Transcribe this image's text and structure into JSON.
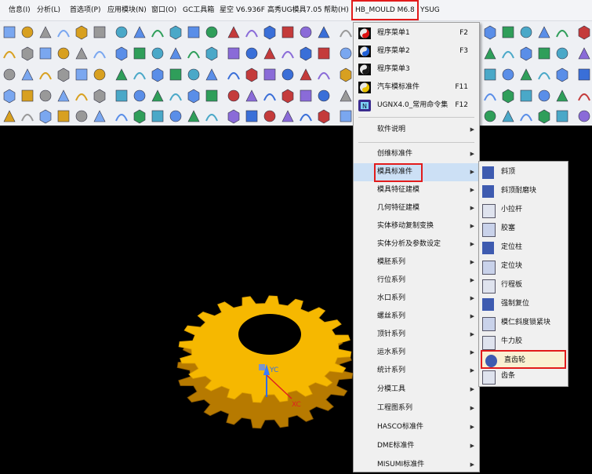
{
  "menubar": {
    "items": [
      "信息(I)",
      "分析(L)",
      "首选项(P)",
      "应用模块(N)",
      "窗口(O)",
      "GC工具箱",
      "星空 V6.936F",
      "高秀UG模具7.05",
      "帮助(H)",
      "HB_MOULD M6.8",
      "YSUG"
    ]
  },
  "main_menu": {
    "items": [
      {
        "label": "程序菜单1",
        "shortcut": "F2"
      },
      {
        "label": "程序菜单2",
        "shortcut": "F3"
      },
      {
        "label": "程序菜单3",
        "shortcut": ""
      },
      {
        "label": "汽车模标准件",
        "shortcut": "F11"
      },
      {
        "label": "UGNX4.0_常用命令集",
        "shortcut": "F12"
      },
      {
        "label": "软件说明",
        "shortcut": ""
      },
      {
        "label": "创维标准件",
        "shortcut": ""
      },
      {
        "label": "模具标准件",
        "shortcut": ""
      },
      {
        "label": "模具特征建模",
        "shortcut": ""
      },
      {
        "label": "几何特征建模",
        "shortcut": ""
      },
      {
        "label": "实体移动复制变换",
        "shortcut": ""
      },
      {
        "label": "实体分析及参数设定",
        "shortcut": ""
      },
      {
        "label": "模胚系列",
        "shortcut": ""
      },
      {
        "label": "行位系列",
        "shortcut": ""
      },
      {
        "label": "水口系列",
        "shortcut": ""
      },
      {
        "label": "螺丝系列",
        "shortcut": ""
      },
      {
        "label": "顶针系列",
        "shortcut": ""
      },
      {
        "label": "运水系列",
        "shortcut": ""
      },
      {
        "label": "统计系列",
        "shortcut": ""
      },
      {
        "label": "分模工具",
        "shortcut": ""
      },
      {
        "label": "工程图系列",
        "shortcut": ""
      },
      {
        "label": "HASCO标准件",
        "shortcut": ""
      },
      {
        "label": "DME标准件",
        "shortcut": ""
      },
      {
        "label": "MISUMI标准件",
        "shortcut": ""
      }
    ]
  },
  "submenu": {
    "items": [
      "斜顶",
      "斜顶耐磨块",
      "小拉杆",
      "胶塞",
      "定位柱",
      "定位块",
      "行程板",
      "强制复位",
      "模仁斜度锁紧块",
      "牛力胶",
      "直齿轮",
      "齿条"
    ]
  },
  "viewport": {
    "axis_y": "YC",
    "axis_x": "XC"
  },
  "colors": {
    "highlight": "#e21b1b",
    "gear": "#f6b800",
    "menu_bg": "#f0f0f0"
  }
}
